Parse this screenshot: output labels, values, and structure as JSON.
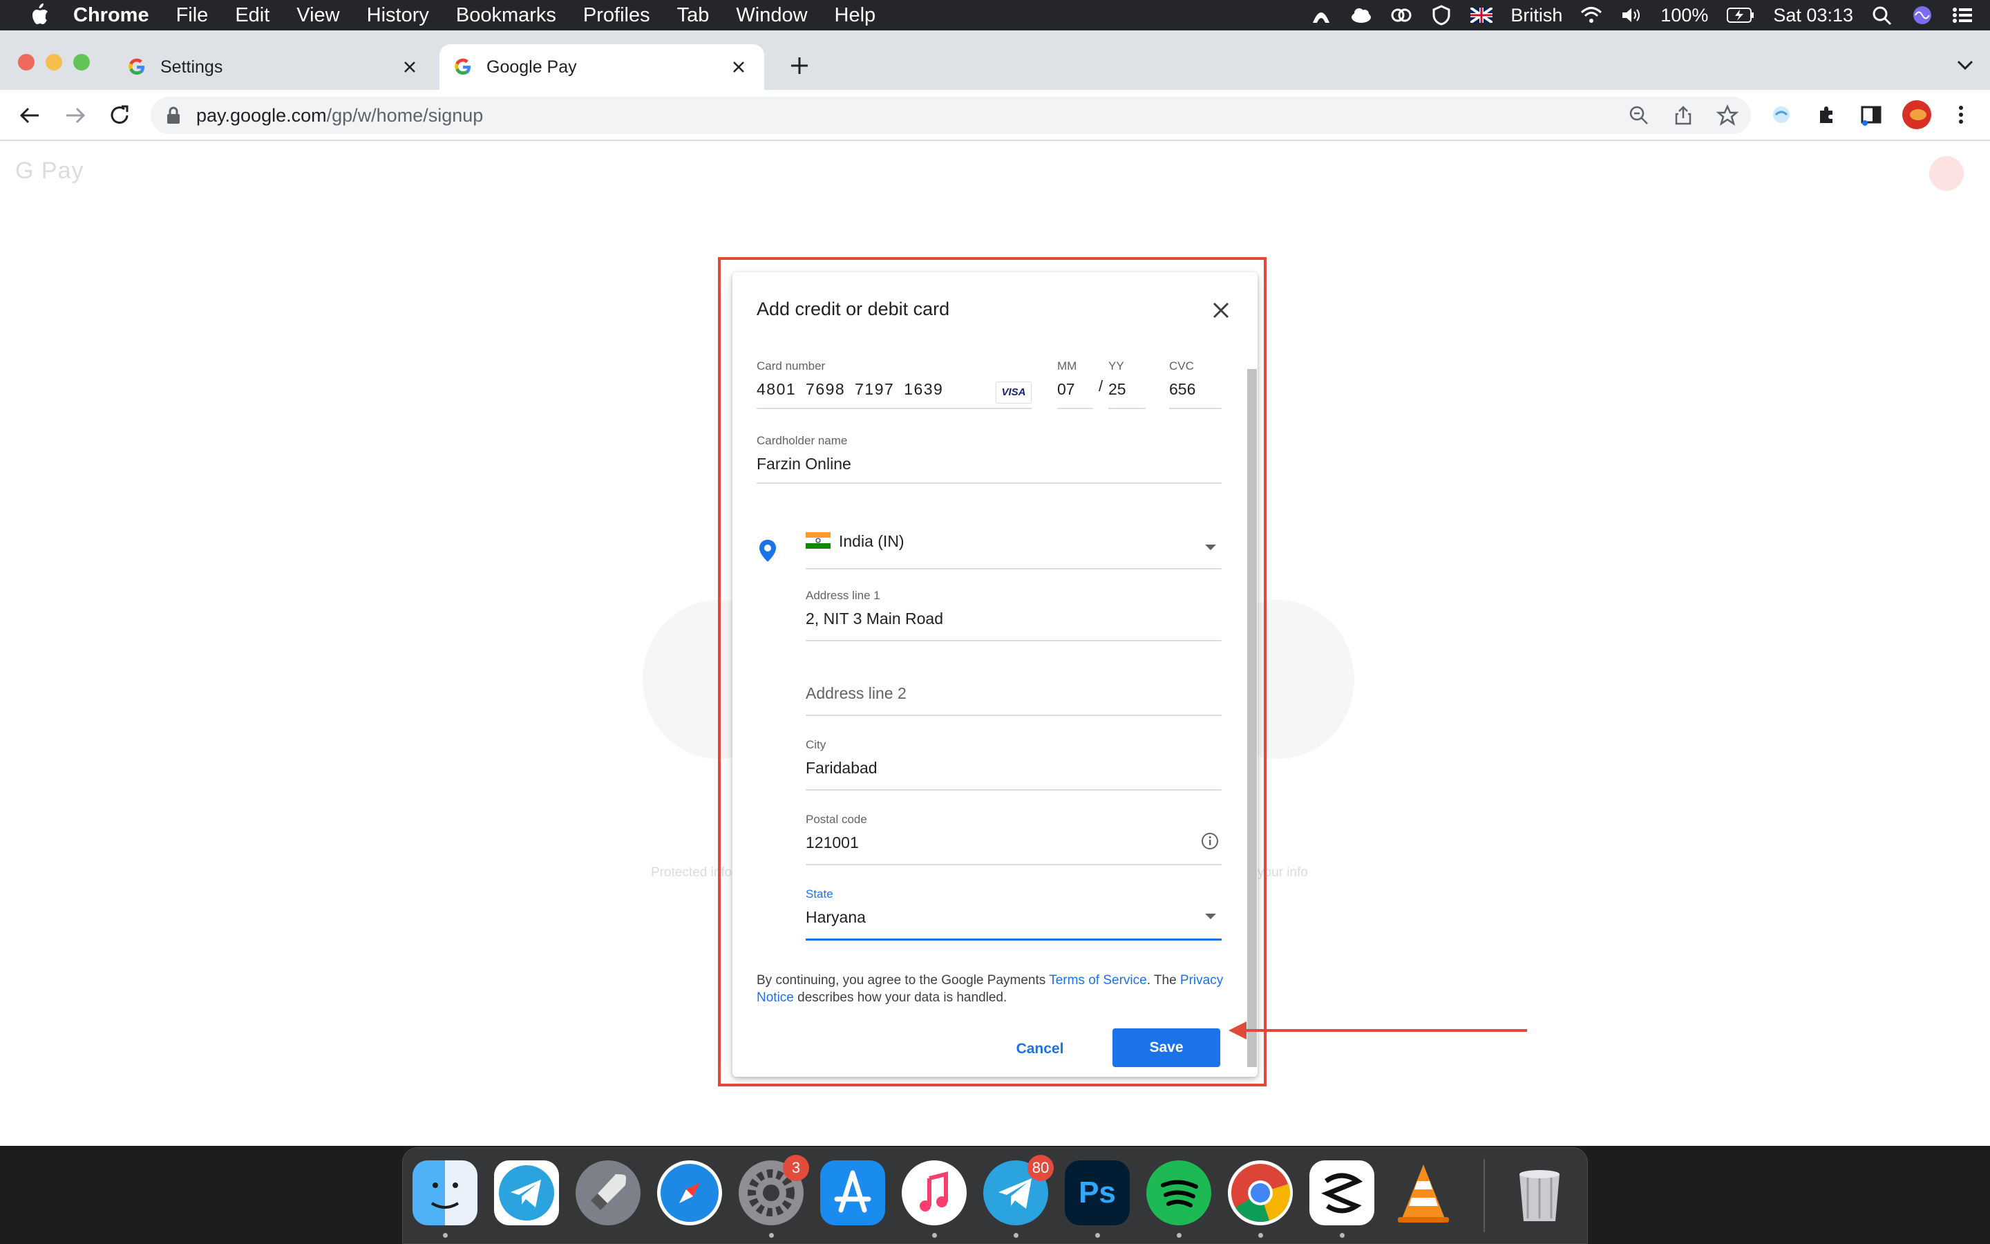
{
  "menubar": {
    "app_name": "Chrome",
    "items": [
      "File",
      "Edit",
      "View",
      "History",
      "Bookmarks",
      "Profiles",
      "Tab",
      "Window",
      "Help"
    ],
    "input_source": "British",
    "battery": "100%",
    "clock": "Sat 03:13"
  },
  "tabs": [
    {
      "title": "Settings",
      "active": false
    },
    {
      "title": "Google Pay",
      "active": true
    }
  ],
  "address_bar": {
    "host": "pay.google.com",
    "path": "/gp/w/home/signup"
  },
  "page": {
    "logo_text": "G Pay",
    "bg_text_left": "Protected info",
    "bg_text_right": "your info"
  },
  "dialog": {
    "title": "Add credit or debit card",
    "card_number": {
      "label": "Card number",
      "value": "4801  7698  7197  1639",
      "brand": "VISA"
    },
    "expiry_month": {
      "label": "MM",
      "value": "07"
    },
    "expiry_year": {
      "label": "YY",
      "value": "25"
    },
    "expiry_separator": "/",
    "cvc": {
      "label": "CVC",
      "value": "656"
    },
    "cardholder": {
      "label": "Cardholder name",
      "value": "Farzin Online"
    },
    "country": {
      "value": "India (IN)"
    },
    "address1": {
      "label": "Address line 1",
      "value": "2, NIT 3 Main Road"
    },
    "address2": {
      "placeholder": "Address line 2"
    },
    "city": {
      "label": "City",
      "value": "Faridabad"
    },
    "postal": {
      "label": "Postal code",
      "value": "121001"
    },
    "state": {
      "label": "State",
      "value": "Haryana"
    },
    "terms": {
      "prefix": "By continuing, you agree to the Google Payments ",
      "tos_link": "Terms of Service",
      "middle": ". The ",
      "privacy_link": "Privacy Notice",
      "suffix": " describes how your data is handled."
    },
    "cancel_label": "Cancel",
    "save_label": "Save"
  },
  "dock": {
    "badges": {
      "system_prefs": "3",
      "telegram2": "80"
    },
    "ps_label": "Ps"
  },
  "colors": {
    "accent": "#1a73e8",
    "annotation": "#e04a3a"
  }
}
